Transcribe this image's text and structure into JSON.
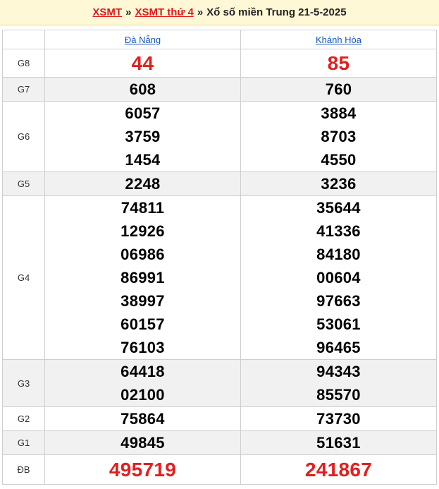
{
  "breadcrumb": {
    "link1": "XSMT",
    "sep": "»",
    "link2": "XSMT thứ 4",
    "title": "Xổ số miền Trung 21-5-2025"
  },
  "columns": [
    "Đà Nẵng",
    "Khánh Hòa"
  ],
  "prizes": {
    "g8": {
      "label": "G8",
      "da_nang": [
        "44"
      ],
      "khanh_hoa": [
        "85"
      ]
    },
    "g7": {
      "label": "G7",
      "da_nang": [
        "608"
      ],
      "khanh_hoa": [
        "760"
      ]
    },
    "g6": {
      "label": "G6",
      "da_nang": [
        "6057",
        "3759",
        "1454"
      ],
      "khanh_hoa": [
        "3884",
        "8703",
        "4550"
      ]
    },
    "g5": {
      "label": "G5",
      "da_nang": [
        "2248"
      ],
      "khanh_hoa": [
        "3236"
      ]
    },
    "g4": {
      "label": "G4",
      "da_nang": [
        "74811",
        "12926",
        "06986",
        "86991",
        "38997",
        "60157",
        "76103"
      ],
      "khanh_hoa": [
        "35644",
        "41336",
        "84180",
        "00604",
        "97663",
        "53061",
        "96465"
      ]
    },
    "g3": {
      "label": "G3",
      "da_nang": [
        "64418",
        "02100"
      ],
      "khanh_hoa": [
        "94343",
        "85570"
      ]
    },
    "g2": {
      "label": "G2",
      "da_nang": [
        "75864"
      ],
      "khanh_hoa": [
        "73730"
      ]
    },
    "g1": {
      "label": "G1",
      "da_nang": [
        "49845"
      ],
      "khanh_hoa": [
        "51631"
      ]
    },
    "db": {
      "label": "ĐB",
      "da_nang": [
        "495719"
      ],
      "khanh_hoa": [
        "241867"
      ]
    }
  },
  "colors": {
    "accent_red": "#e0201f",
    "link_blue": "#1a56b8",
    "breadcrumb_bg": "#fff8d6",
    "alt_row": "#f1f1f1"
  }
}
